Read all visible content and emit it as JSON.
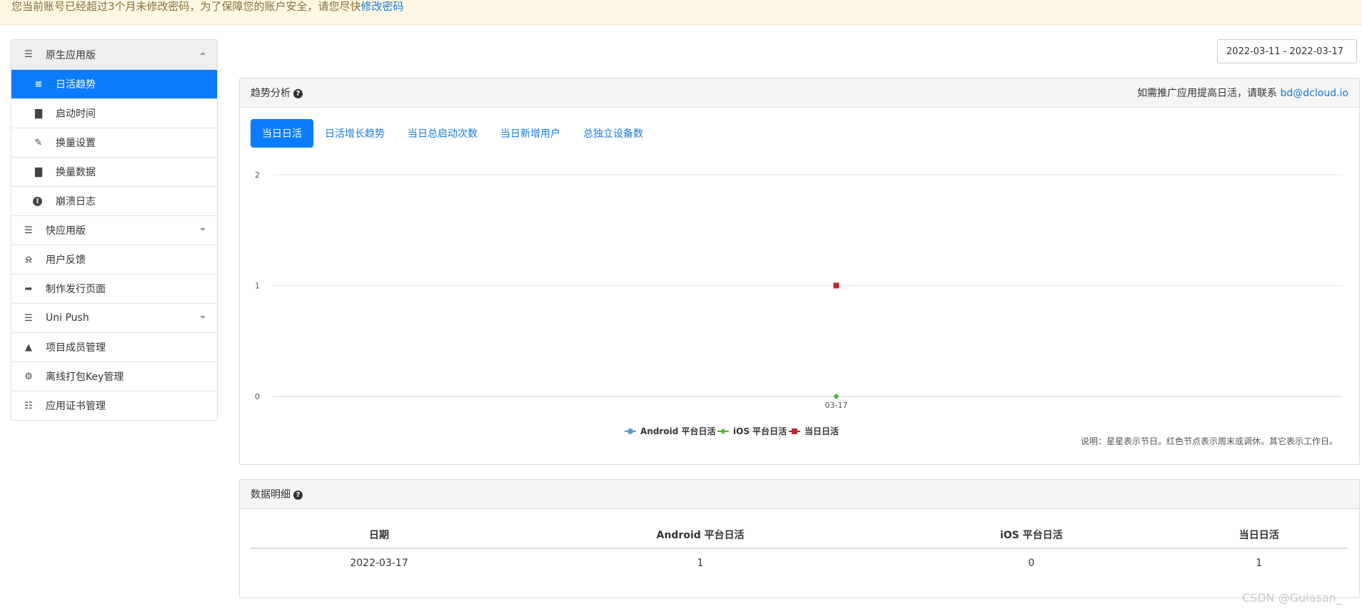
{
  "banner": {
    "text": "您当前账号已经超过3个月未修改密码，为了保障您的账户安全，请您尽快",
    "link": "修改密码"
  },
  "sidebar": {
    "items": [
      {
        "label": "原生应用版",
        "icon": "menu-icon",
        "kind": "group",
        "caret": "up"
      },
      {
        "label": "日活趋势",
        "icon": "align-left-icon",
        "kind": "sub",
        "active": true
      },
      {
        "label": "启动时间",
        "icon": "bar-chart-icon",
        "kind": "sub"
      },
      {
        "label": "换量设置",
        "icon": "edit-icon",
        "kind": "sub"
      },
      {
        "label": "换量数据",
        "icon": "bar-chart-icon",
        "kind": "sub"
      },
      {
        "label": "崩溃日志",
        "icon": "alert-circle-icon",
        "kind": "sub"
      },
      {
        "label": "快应用版",
        "icon": "menu-icon",
        "kind": "group-plain",
        "caret": "down"
      },
      {
        "label": "用户反馈",
        "icon": "bell-icon",
        "kind": "top"
      },
      {
        "label": "制作发行页面",
        "icon": "share-icon",
        "kind": "top"
      },
      {
        "label": "Uni Push",
        "icon": "menu-icon",
        "kind": "top",
        "caret": "down"
      },
      {
        "label": "项目成员管理",
        "icon": "user-icon",
        "kind": "top"
      },
      {
        "label": "离线打包Key管理",
        "icon": "gear-icon",
        "kind": "top"
      },
      {
        "label": "应用证书管理",
        "icon": "list-icon",
        "kind": "top"
      }
    ]
  },
  "date_range": "2022-03-11 - 2022-03-17",
  "trend": {
    "title": "趋势分析",
    "contact_text": "如需推广应用提高日活，请联系",
    "contact_email": "bd@dcloud.io",
    "tabs": [
      "当日日活",
      "日活增长趋势",
      "当日总启动次数",
      "当日新增用户",
      "总独立设备数"
    ],
    "note": "说明：星星表示节日。红色节点表示周末或调休。其它表示工作日。"
  },
  "chart_data": {
    "type": "line",
    "categories": [
      "03-17"
    ],
    "series": [
      {
        "name": "Android 平台日活",
        "values": [
          0
        ],
        "color": "#5b9bd5",
        "marker": "circle"
      },
      {
        "name": "iOS 平台日活",
        "values": [
          0
        ],
        "color": "#52b82a",
        "marker": "diamond"
      },
      {
        "name": "当日日活",
        "values": [
          1
        ],
        "color": "#c0282d",
        "marker": "square"
      }
    ],
    "yticks": [
      0,
      1,
      2
    ],
    "ylim": [
      0,
      2
    ],
    "grid": true,
    "legend_position": "bottom-center"
  },
  "detail": {
    "title": "数据明细",
    "columns": [
      "日期",
      "Android 平台日活",
      "iOS 平台日活",
      "当日日活"
    ],
    "rows": [
      [
        "2022-03-17",
        "1",
        "0",
        "1"
      ]
    ]
  },
  "watermark": "CSDN @Guiasan_"
}
